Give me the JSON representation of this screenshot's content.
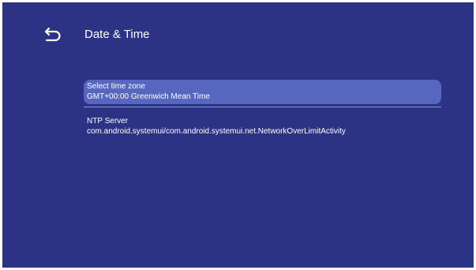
{
  "header": {
    "title": "Date & Time",
    "back_icon": "back-arrow-icon"
  },
  "settings": {
    "timezone": {
      "label": "Select time zone",
      "value": "GMT+00:00 Greenwich Mean Time",
      "selected": true
    },
    "ntp": {
      "label": "NTP Server",
      "value": "com.android.systemui/com.android.systemui.net.NetworkOverLimitActivity"
    }
  },
  "colors": {
    "background": "#2c3384",
    "selection": "#5767c0",
    "divider": "#8e95cf",
    "text": "#ffffff"
  }
}
